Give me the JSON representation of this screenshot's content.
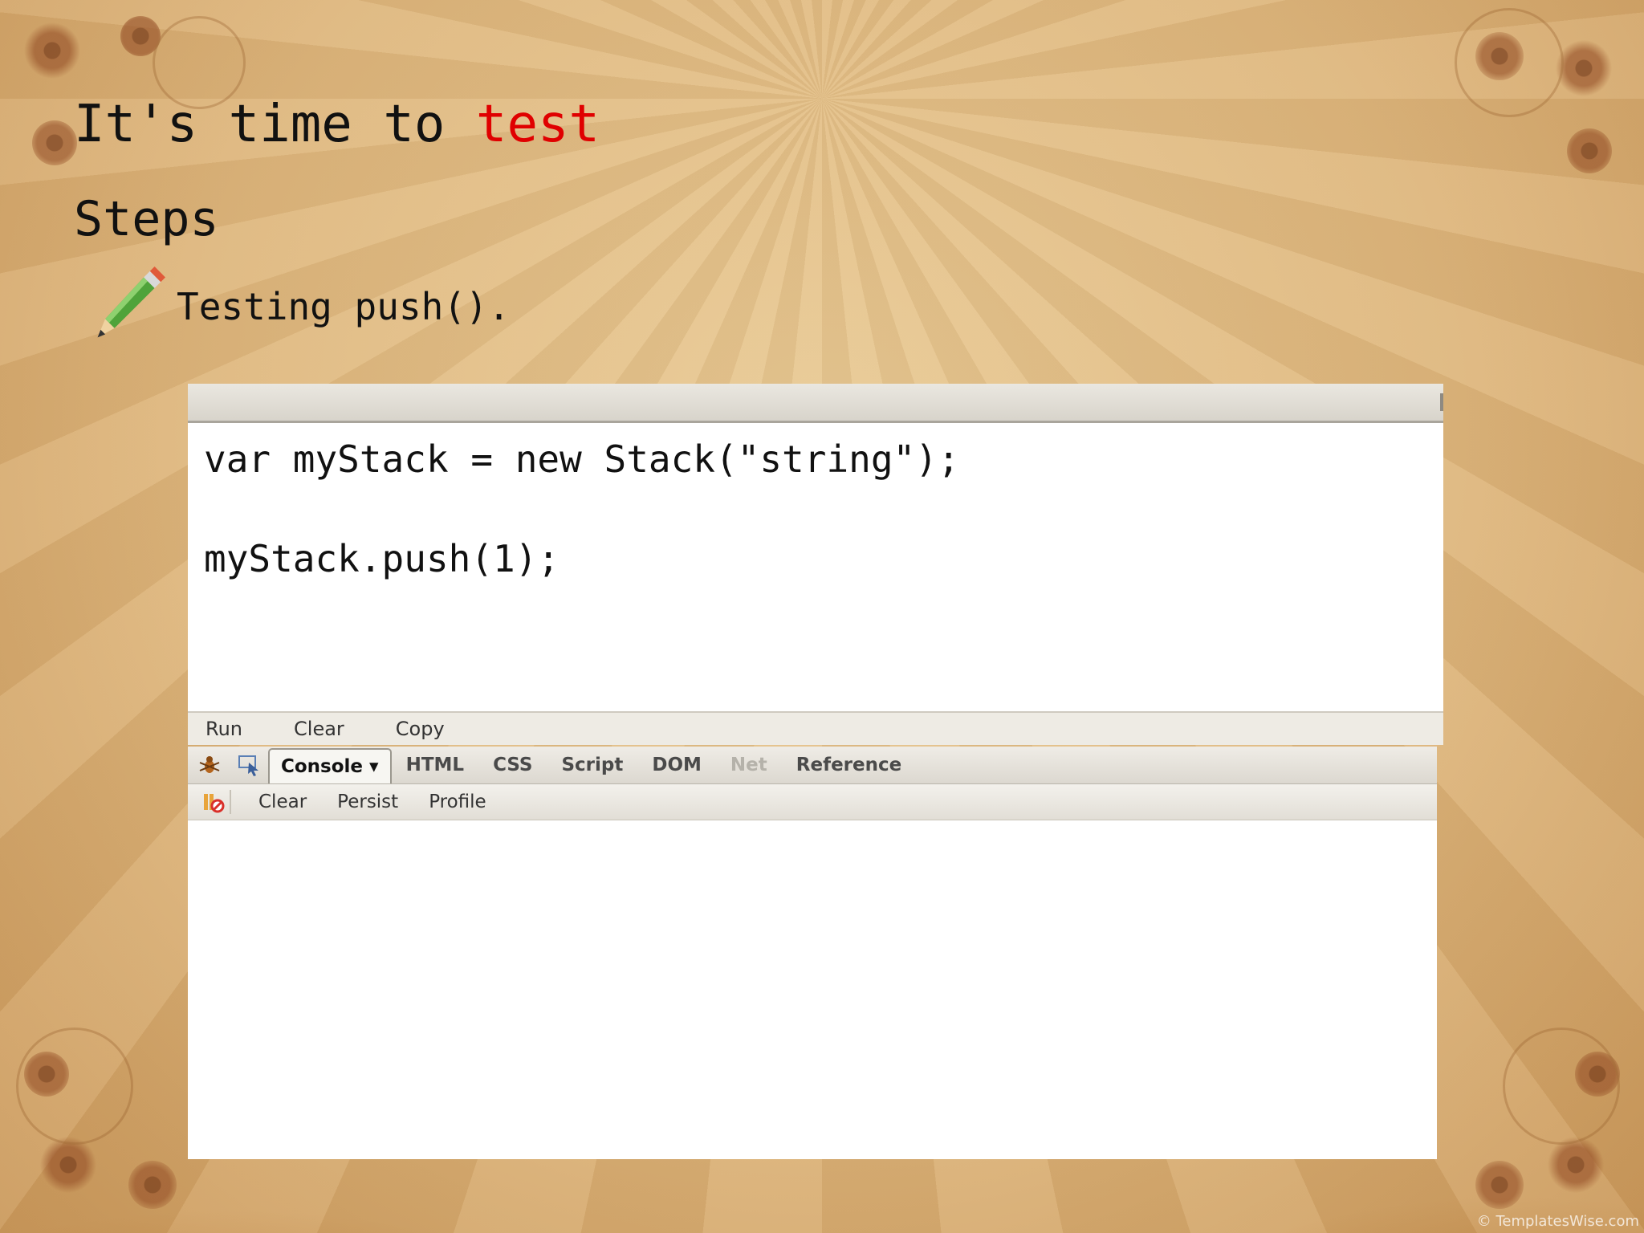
{
  "slide": {
    "title_prefix": "It's time to ",
    "title_accent": "test",
    "subtitle": "Steps",
    "bullet": "Testing push().",
    "accent_color": "#e00000",
    "bullet_icon": "pencil-icon"
  },
  "editor": {
    "code_lines": [
      "var myStack = new Stack(\"string\");",
      "",
      "myStack.push(1);"
    ],
    "actions": [
      "Run",
      "Clear",
      "Copy"
    ]
  },
  "firebug": {
    "tool_icons": [
      "firebug-bug-icon",
      "inspect-icon"
    ],
    "tabs": [
      "Console ▾",
      "HTML",
      "CSS",
      "Script",
      "DOM",
      "Net",
      "Reference"
    ],
    "active_tab": "Console",
    "disabled_tab": "Net",
    "sub_icon": "clear-console-icon",
    "sub_toolbar": [
      "Clear",
      "Persist",
      "Profile"
    ]
  },
  "watermark": "© TemplatesWise.com"
}
